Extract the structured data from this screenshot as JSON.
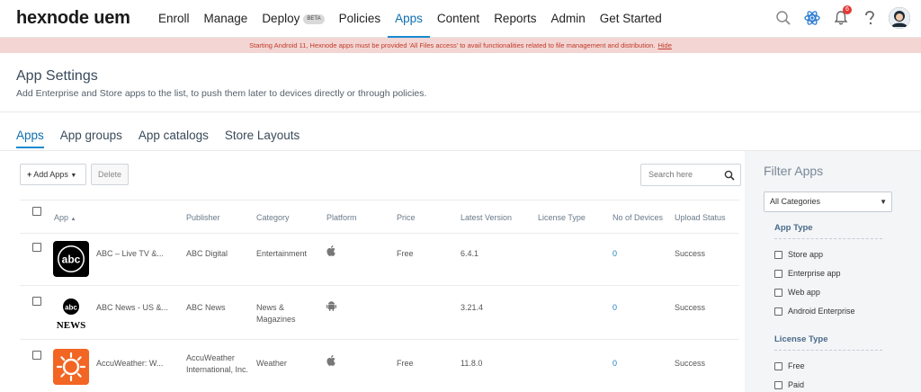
{
  "header": {
    "logo": "hexnode uem",
    "nav": [
      {
        "label": "Enroll"
      },
      {
        "label": "Manage"
      },
      {
        "label": "Deploy",
        "badge": "BETA"
      },
      {
        "label": "Policies"
      },
      {
        "label": "Apps",
        "active": true
      },
      {
        "label": "Content"
      },
      {
        "label": "Reports"
      },
      {
        "label": "Admin"
      },
      {
        "label": "Get Started"
      }
    ],
    "notification_count": "6"
  },
  "banner": {
    "text": "Starting Android 11, Hexnode apps must be provided 'All Files access' to avail functionalities related to file management and distribution.",
    "link": "Hide"
  },
  "page": {
    "title": "App Settings",
    "subtitle": "Add Enterprise and Store apps to the list, to push them later to devices directly or through policies."
  },
  "tabs": [
    "Apps",
    "App groups",
    "App catalogs",
    "Store Layouts"
  ],
  "toolbar": {
    "add_label": "Add Apps",
    "delete_label": "Delete",
    "search_placeholder": "Search here"
  },
  "table": {
    "columns": [
      "App",
      "Publisher",
      "Category",
      "Platform",
      "Price",
      "Latest Version",
      "License Type",
      "No of Devices",
      "Upload Status"
    ],
    "rows": [
      {
        "app": "ABC – Live TV &...",
        "publisher": "ABC Digital",
        "category": "Entertainment",
        "platform": "apple",
        "price": "Free",
        "version": "6.4.1",
        "license": "",
        "devices": "0",
        "status": "Success"
      },
      {
        "app": "ABC News - US &...",
        "publisher": "ABC News",
        "category": "News & Magazines",
        "platform": "android",
        "price": "",
        "version": "3.21.4",
        "license": "",
        "devices": "0",
        "status": "Success"
      },
      {
        "app": "AccuWeather: W...",
        "publisher": "AccuWeather International, Inc.",
        "category": "Weather",
        "platform": "apple",
        "price": "Free",
        "version": "11.8.0",
        "license": "",
        "devices": "0",
        "status": "Success"
      }
    ]
  },
  "filter": {
    "title": "Filter Apps",
    "category_select": "All Categories",
    "app_type_title": "App Type",
    "app_types": [
      "Store app",
      "Enterprise app",
      "Web app",
      "Android Enterprise"
    ],
    "license_title": "License Type",
    "license_types": [
      "Free",
      "Paid"
    ]
  },
  "colors": {
    "accent": "#1a8ad0",
    "banner_bg": "#f3d6d3",
    "banner_text": "#c0392b",
    "link_blue": "#1a7cc0"
  }
}
